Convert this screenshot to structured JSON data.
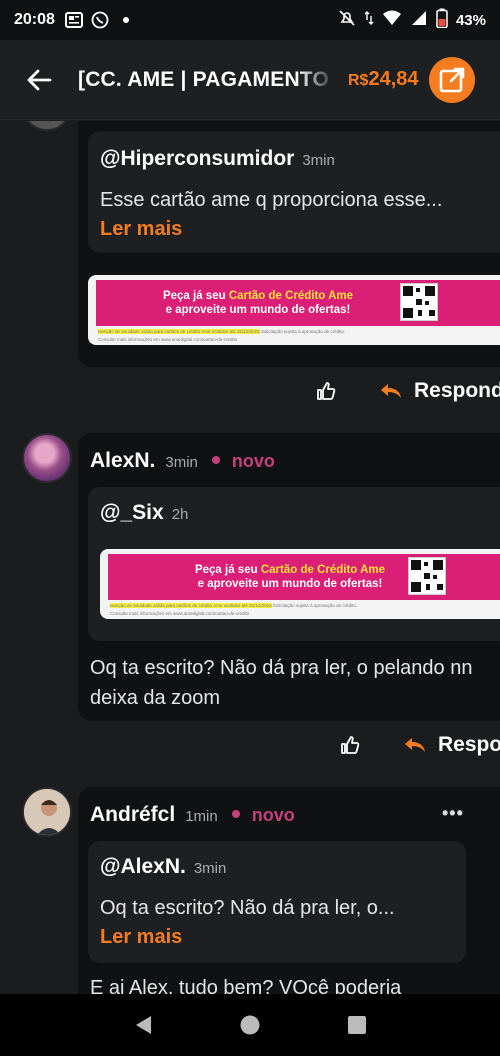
{
  "status": {
    "time": "20:08",
    "battery": "43%"
  },
  "header": {
    "title": "[CC. AME | PAGAMENTO",
    "currency": "R$",
    "price": "24,84"
  },
  "comments": [
    {
      "quote": {
        "name": "@Hiperconsumidor",
        "time": "3min",
        "text": "Esse cartão ame q proporciona esse...",
        "more": "Ler mais"
      },
      "reply_label": "Responder"
    },
    {
      "author": "AlexN.",
      "time": "3min",
      "badge": "novo",
      "quote": {
        "name": "@_Six",
        "time": "2h"
      },
      "text_lines": [
        "Oq ta escrito? Não dá pra ler, o pelando nn",
        "deixa da zoom"
      ],
      "reply_label": "Responder"
    },
    {
      "author": "Andréfcl",
      "time": "1min",
      "badge": "novo",
      "more_options": "•••",
      "quote": {
        "name": "@AlexN.",
        "time": "3min",
        "text": "Oq ta escrito? Não dá pra ler, o...",
        "more": "Ler mais"
      },
      "text_lines": [
        "E ai Alex, tudo bem? VOcê poderia"
      ]
    }
  ],
  "banner": {
    "line1_pre": "Peça já seu ",
    "line1_highlight": "Cartão de Crédito Ame",
    "line2": "e aproveite um mundo de ofertas!",
    "fine1_highlight": "Isenção de anuidade válida para cartões de crédito Ame emitidos até 31/12/2022",
    "fine1_rest": " Solicitação sujeita à aprovação de crédito.",
    "fine2": "Consulte mais informações em www.amedigital.com/cartao-de-credito"
  },
  "colors": {
    "accent": "#f57c1f",
    "badge": "#c2417a",
    "banner_pink": "#dc1f76"
  }
}
